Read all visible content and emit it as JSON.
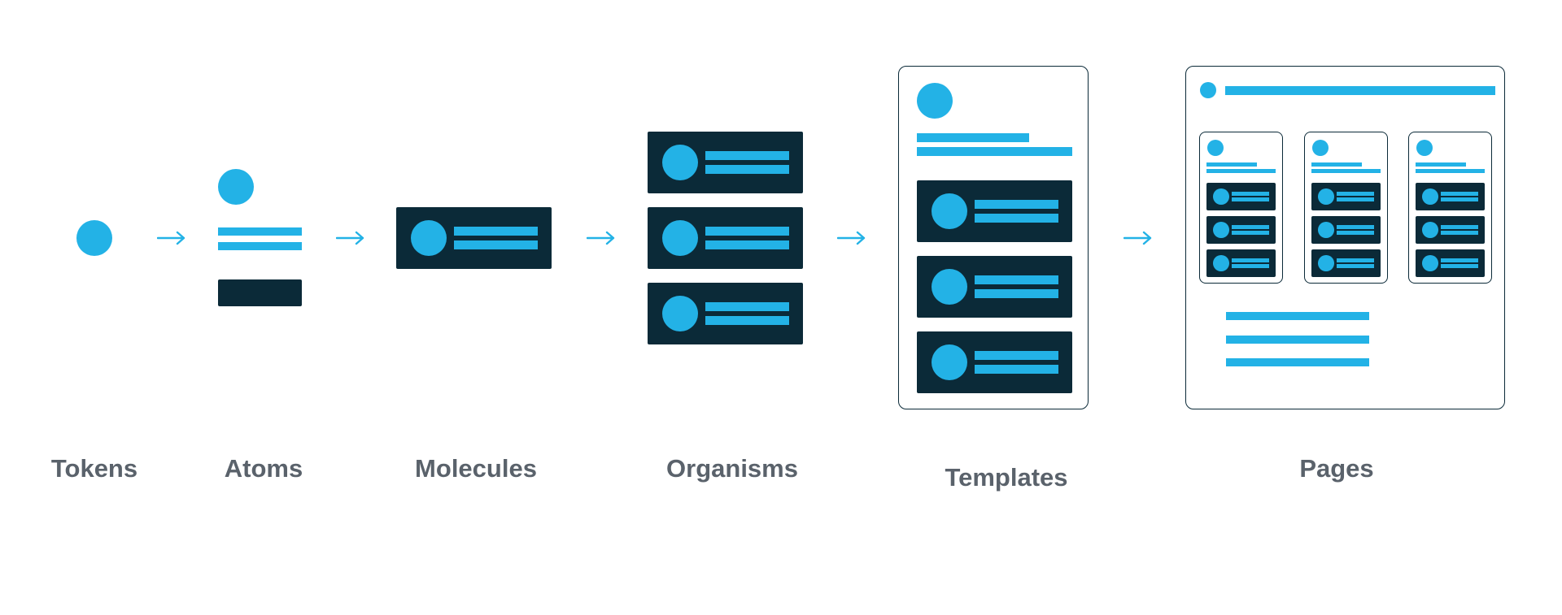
{
  "stages": [
    {
      "label": "Tokens"
    },
    {
      "label": "Atoms"
    },
    {
      "label": "Molecules"
    },
    {
      "label": "Organisms"
    },
    {
      "label": "Templates"
    },
    {
      "label": "Pages"
    }
  ],
  "colors": {
    "accent": "#23b2e6",
    "dark": "#0b2a38",
    "label": "#5a626b"
  },
  "icons": {
    "connector": "arrow-right-icon"
  }
}
